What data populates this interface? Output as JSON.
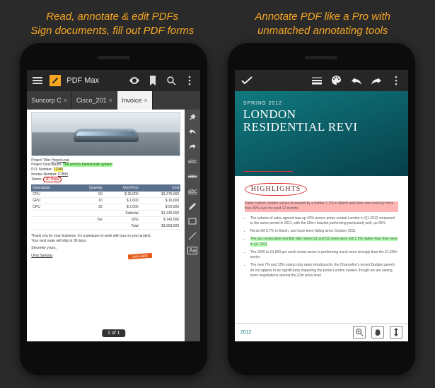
{
  "captions": {
    "left": "Read, annotate & edit PDFs\nSign documents, fill out PDF forms",
    "right": "Annotate PDF like a Pro with\nunmatched annotating tools"
  },
  "left_phone": {
    "app_title": "PDF Max",
    "tabs": [
      {
        "label": "Suncorp C",
        "active": false
      },
      {
        "label": "Cisco_201",
        "active": false
      },
      {
        "label": "Invoice",
        "active": true
      }
    ],
    "meta": {
      "project_title_label": "Project Title:",
      "project_title_value": "HyperLoop",
      "project_desc_label": "Project Description:",
      "project_desc_value": "The world's fastest train system",
      "po_label": "P.O. Number:",
      "po_value": "12345",
      "invoice_label": "Invoice Number:",
      "invoice_value": "67890",
      "terms_label": "Terms:",
      "terms_value": "30 Days"
    },
    "table": {
      "headers": [
        "Description",
        "Quantity",
        "Unit Price",
        "Cost"
      ],
      "rows": [
        [
          "CPU",
          "50",
          "$ 25,000",
          "$1,375,000"
        ],
        [
          "GPU",
          "10",
          "$ 1,600",
          "$ 16,000"
        ],
        [
          "CPU",
          "25",
          "$ 2,000",
          "$ 50,000"
        ]
      ],
      "subtotal_label": "Subtotal",
      "subtotal": "$1,435,000",
      "tax_label": "Tax",
      "tax_rate": "10%",
      "tax": "$ 143,500",
      "total_label": "Total",
      "total": "$1,583,500"
    },
    "thanks": "Thank you for your business. It's a pleasure to work with you on your project.\nYour next order will ship in 30 days.",
    "sincerely": "Sincerely yours,",
    "signature": "Uma Sampas",
    "stamp": "SIGN HERE",
    "pager": "1 of 1",
    "side_tools": [
      {
        "name": "pin-icon"
      },
      {
        "name": "undo-icon"
      },
      {
        "name": "redo-icon"
      },
      {
        "name": "text-abc-icon",
        "label": "abc"
      },
      {
        "name": "strike-icon",
        "label": "abc"
      },
      {
        "name": "underline-icon",
        "label": "abc"
      },
      {
        "name": "pen-icon"
      },
      {
        "name": "rect-icon"
      },
      {
        "name": "line-icon"
      },
      {
        "name": "textbox-icon",
        "label": "Aa"
      }
    ]
  },
  "right_phone": {
    "cover_sub": "SPRING 2012",
    "cover_title": "LONDON\nRESIDENTIAL REVI",
    "highlights_label": "HIGHLIGHTS",
    "hl_lines": [
      {
        "text": "Prime central London values increased by a further 1.1% in March and have now risen by more than 40% over the past 12 months",
        "cls": "hl-yel hl-red"
      },
      {
        "text": "The volume of sales agreed was up 42% across prime central London in Q1 2012 compared to the same period in 2011, with the £5m+ bracket performing particularly well, up 95%",
        "cls": ""
      },
      {
        "text": "Rents fell 0.7% in March, and have been falling since October 2011",
        "cls": ""
      },
      {
        "text": "The six consecutive monthly falls mean Q1 and Q2 rents were still 1.2% higher than they were in Q1 2011",
        "cls": "hl-grn"
      },
      {
        "text": "The £500 to £1,500 per week rental sector is performing much more strongly than the £1,500+ sector",
        "cls": ""
      },
      {
        "text": "The new 7% and 15% stamp duty rates introduced in the Chancellor's recent Budget speech do not appear to be significantly impacting the prime London market, though we are seeing more negotiations around the £2m price level",
        "cls": ""
      }
    ],
    "footer_year": "2012"
  }
}
